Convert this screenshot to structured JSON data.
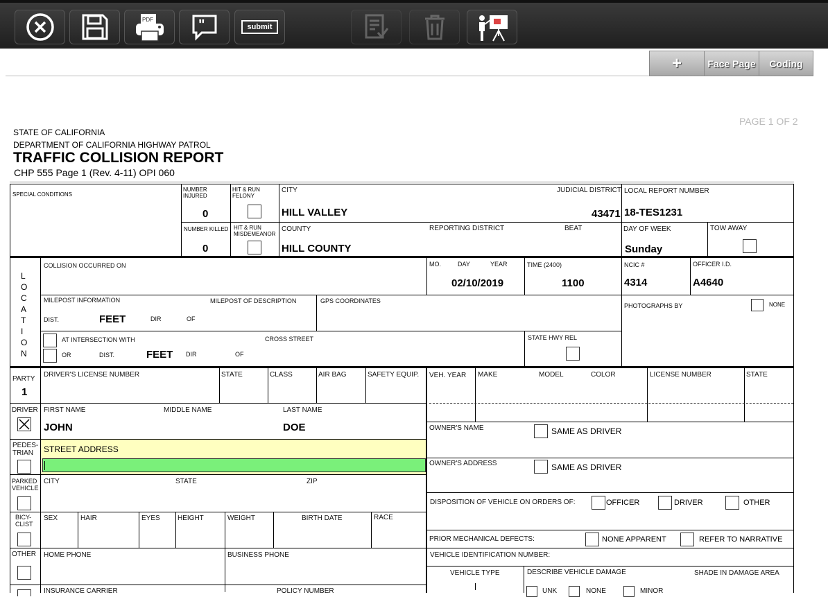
{
  "toolbar": {
    "buttons": [
      {
        "name": "close-icon",
        "label": "Close"
      },
      {
        "name": "save-icon",
        "label": "Save"
      },
      {
        "name": "print-pdf-icon",
        "label": "PDF"
      },
      {
        "name": "comment-icon",
        "label": "Comment"
      },
      {
        "name": "submit-icon",
        "label": "submit"
      },
      {
        "name": "review-icon",
        "label": "Review"
      },
      {
        "name": "trash-icon",
        "label": "Delete"
      },
      {
        "name": "presentation-icon",
        "label": "Present"
      }
    ]
  },
  "tabs": {
    "add_label": "+",
    "face_page": "Face Page",
    "coding": "Coding"
  },
  "page_indicator": "PAGE 1 OF 2",
  "header": {
    "state": "STATE OF CALIFORNIA",
    "department": "DEPARTMENT OF CALIFORNIA HIGHWAY PATROL",
    "title": "TRAFFIC COLLISION REPORT",
    "form_id": "CHP 555 Page 1 (Rev. 4-11) OPI 060"
  },
  "labels": {
    "special_conditions": "SPECIAL CONDITIONS",
    "number_injured_1": "NUMBER",
    "number_injured_2": "INJURED",
    "hit_run_felony_1": "HIT & RUN",
    "hit_run_felony_2": "FELONY",
    "city": "CITY",
    "judicial_district": "JUDICIAL DISTRICT",
    "local_report_number": "LOCAL REPORT NUMBER",
    "number_killed": "NUMBER KILLED",
    "hit_run_misd_1": "HIT & RUN",
    "hit_run_misd_2": "MISDEMEANOR",
    "county": "COUNTY",
    "reporting_district": "REPORTING DISTRICT",
    "beat": "BEAT",
    "day_of_week": "DAY OF WEEK",
    "tow_away": "TOW AWAY",
    "location_vertical": "L\nO\nC\nA\nT\nI\nO\nN",
    "collision_occurred_on": "COLLISION OCCURRED ON",
    "mo": "MO.",
    "day": "DAY",
    "year": "YEAR",
    "time": "TIME (2400)",
    "ncic": "NCIC #",
    "officer_id": "OFFICER I.D.",
    "milepost_information": "MILEPOST INFORMATION",
    "milepost_description": "MILEPOST OF DESCRIPTION",
    "gps_coordinates": "GPS COORDINATES",
    "photographs_by": "PHOTOGRAPHS BY",
    "none": "NONE",
    "dist": "DIST.",
    "feet": "FEET",
    "dir": "DIR",
    "of": "OF",
    "at_intersection_with": "AT INTERSECTION WITH",
    "cross_street": "CROSS STREET",
    "state_hwy_rel": "STATE HWY REL",
    "or": "OR",
    "party": "PARTY",
    "drivers_license_number": "DRIVER'S LICENSE NUMBER",
    "state": "STATE",
    "class": "CLASS",
    "air_bag": "AIR BAG",
    "safety_equip": "SAFETY EQUIP.",
    "veh_year": "VEH. YEAR",
    "make": "MAKE",
    "model": "MODEL",
    "color": "COLOR",
    "license_number": "LICENSE NUMBER",
    "lic_state": "STATE",
    "driver": "DRIVER",
    "first_name": "FIRST NAME",
    "middle_name": "MIDDLE NAME",
    "last_name": "LAST NAME",
    "owners_name": "OWNER'S NAME",
    "same_as_driver": "SAME AS DRIVER",
    "pedestrian_1": "PEDES-",
    "pedestrian_2": "TRIAN",
    "street_address": "STREET ADDRESS",
    "owners_address": "OWNER'S ADDRESS",
    "parked_1": "PARKED",
    "parked_2": "VEHICLE",
    "addr_city": "CITY",
    "addr_state": "STATE",
    "zip": "ZIP",
    "disposition": "DISPOSITION OF VEHICLE ON ORDERS OF:",
    "officer": "OFFICER",
    "disp_driver": "DRIVER",
    "other_opt": "OTHER",
    "bicyclist_1": "BICY-",
    "bicyclist_2": "CLIST",
    "sex": "SEX",
    "hair": "HAIR",
    "eyes": "EYES",
    "height": "HEIGHT",
    "weight": "WEIGHT",
    "birth_date": "BIRTH DATE",
    "race": "RACE",
    "prior_mech": "PRIOR MECHANICAL DEFECTS:",
    "none_apparent": "NONE APPARENT",
    "refer_narrative": "REFER TO NARRATIVE",
    "other": "OTHER",
    "home_phone": "HOME PHONE",
    "business_phone": "BUSINESS PHONE",
    "vin": "VEHICLE IDENTIFICATION NUMBER:",
    "vehicle_type": "VEHICLE TYPE",
    "describe_damage": "DESCRIBE VEHICLE DAMAGE",
    "shade_damage": "SHADE IN DAMAGE AREA",
    "insurance_carrier": "INSURANCE CARRIER",
    "policy_number": "POLICY NUMBER",
    "unk": "UNK",
    "dmg_none": "NONE",
    "minor": "MINOR"
  },
  "values": {
    "number_injured": "0",
    "number_killed": "0",
    "city": "HILL VALLEY",
    "judicial_district": "43471",
    "local_report_number": "18-TES1231",
    "county": "HILL COUNTY",
    "day_of_week": "Sunday",
    "date": "02/10/2019",
    "time": "1100",
    "ncic": "4314",
    "officer_id": "A4640",
    "party_number": "1",
    "first_name": "JOHN",
    "last_name": "DOE"
  },
  "colors": {
    "street_address_bg": "#ffffc0",
    "street_address_input": "#7af07a"
  }
}
